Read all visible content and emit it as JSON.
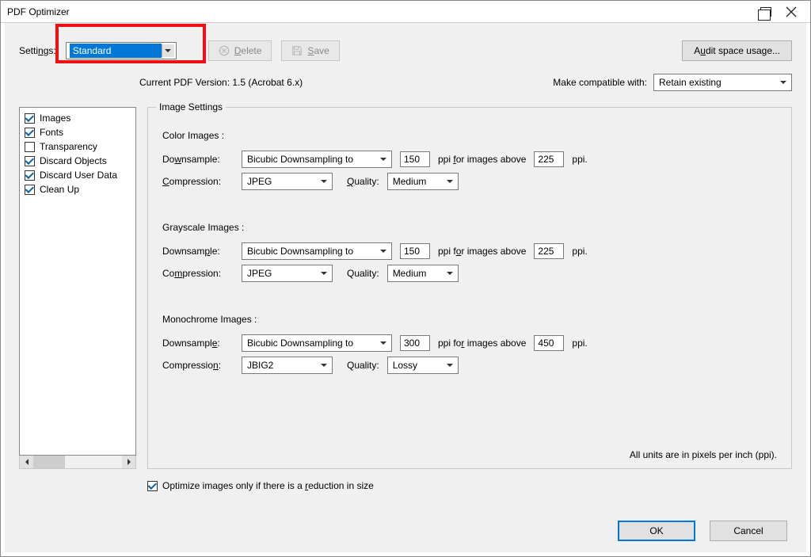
{
  "title": "PDF Optimizer",
  "top": {
    "settings_label": "Settings:",
    "settings_value": "Standard",
    "delete_label": "Delete",
    "save_label": "Save",
    "audit_label": "Audit space usage..."
  },
  "version": {
    "current_label": "Current PDF Version: 1.5 (Acrobat 6.x)",
    "compat_label": "Make compatible with:",
    "compat_value": "Retain existing"
  },
  "sidebar": {
    "items": [
      {
        "label": "Images",
        "checked": true
      },
      {
        "label": "Fonts",
        "checked": true
      },
      {
        "label": "Transparency",
        "checked": false
      },
      {
        "label": "Discard Objects",
        "checked": true
      },
      {
        "label": "Discard User Data",
        "checked": true
      },
      {
        "label": "Clean Up",
        "checked": true
      }
    ]
  },
  "panel": {
    "title": "Image Settings",
    "downsample_label": "Downsample:",
    "compression_label": "Compression:",
    "quality_label": "Quality:",
    "ppi_for_label": "ppi for images above",
    "ppi_suffix": "ppi.",
    "color": {
      "heading": "Color Images :",
      "downsample": "Bicubic Downsampling to",
      "ppi": "150",
      "above": "225",
      "compression": "JPEG",
      "quality": "Medium"
    },
    "gray": {
      "heading": "Grayscale Images :",
      "downsample": "Bicubic Downsampling to",
      "ppi": "150",
      "above": "225",
      "compression": "JPEG",
      "quality": "Medium"
    },
    "mono": {
      "heading": "Monochrome Images :",
      "downsample": "Bicubic Downsampling to",
      "ppi": "300",
      "above": "450",
      "compression": "JBIG2",
      "quality": "Lossy"
    },
    "footnote": "All units are in pixels per inch (ppi)."
  },
  "optimize_row": "Optimize images only if there is a reduction in size",
  "footer": {
    "ok": "OK",
    "cancel": "Cancel"
  },
  "hotkeys": {
    "audit": "A<u>u</u>dit space usage...",
    "settings": "Setti<u>n</u>gs:",
    "delete": "<u>D</u>elete",
    "save": "<u>S</u>ave",
    "downsample": "Do<u>w</u>nsample:",
    "compression": "<u>C</u>ompression:",
    "compression2": "Co<u>m</u>pression:",
    "compression3": "Compressio<u>n</u>:",
    "quality": "<u>Q</u>uality:",
    "ppifor": "ppi <u>f</u>or images above",
    "ppifor2": "ppi f<u>o</u>r images above",
    "optimize": "Optimize images only if there is a <u>r</u>eduction in size"
  }
}
